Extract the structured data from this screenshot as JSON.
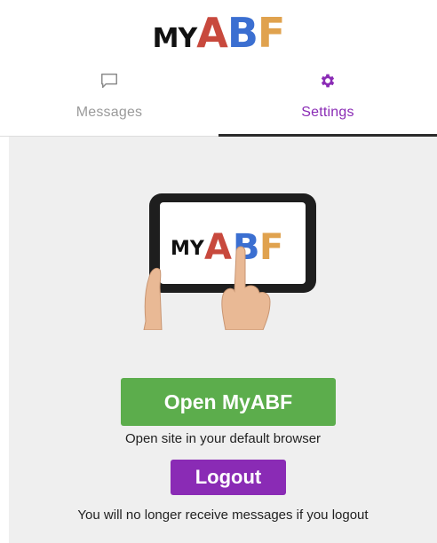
{
  "header": {
    "logo_my": "MY",
    "logo_a": "A",
    "logo_b": "B",
    "logo_f": "F"
  },
  "colors": {
    "logo_a": "#c8493d",
    "logo_b": "#3b6fd1",
    "logo_f": "#e0a24e",
    "accent_purple": "#8a2bb5",
    "button_green": "#5cad4c",
    "panel_bg": "#efefef"
  },
  "tabs": [
    {
      "label": "Messages",
      "icon": "message-square-icon",
      "active": false
    },
    {
      "label": "Settings",
      "icon": "gear-icon",
      "active": true
    }
  ],
  "settings": {
    "illustration": {
      "screen_my": "MY",
      "screen_a": "A",
      "screen_b": "B",
      "screen_f": "F"
    },
    "open_button_label": "Open MyABF",
    "open_caption": "Open site in your default browser",
    "logout_button_label": "Logout",
    "logout_caption": "You will no longer receive messages if you logout"
  }
}
